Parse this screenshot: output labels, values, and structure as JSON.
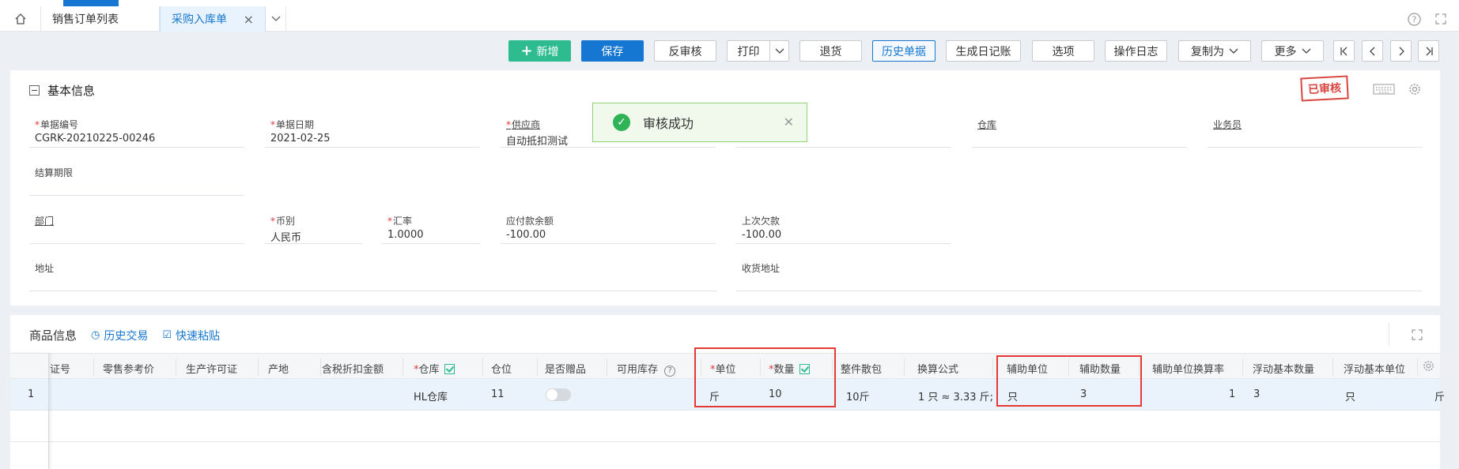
{
  "tabs": {
    "tab1": "销售订单列表",
    "tab2": "采购入库单"
  },
  "toolbar": {
    "add": "新增",
    "save": "保存",
    "unaudit": "反审核",
    "print": "打印",
    "return": "退货",
    "history": "历史单据",
    "journal": "生成日记账",
    "options": "选项",
    "oplog": "操作日志",
    "copyas": "复制为",
    "more": "更多"
  },
  "basic": {
    "title": "基本信息",
    "stamp": "已审核",
    "fields": {
      "doc_no": {
        "label": "单据编号",
        "value": "CGRK-20210225-00246"
      },
      "doc_date": {
        "label": "单据日期",
        "value": "2021-02-25"
      },
      "supplier": {
        "label": "供应商",
        "value": "自动抵扣测试"
      },
      "warehouse": {
        "label": "仓库",
        "value": ""
      },
      "salesman": {
        "label": "业务员",
        "value": ""
      },
      "settle": {
        "label": "结算期限",
        "value": ""
      },
      "dept": {
        "label": "部门",
        "value": ""
      },
      "currency": {
        "label": "币别",
        "value": "人民币"
      },
      "rate": {
        "label": "汇率",
        "value": "1.0000"
      },
      "payable": {
        "label": "应付款余额",
        "value": "-100.00"
      },
      "last_debt": {
        "label": "上次欠款",
        "value": "-100.00"
      },
      "address": {
        "label": "地址",
        "value": ""
      },
      "recv_address": {
        "label": "收货地址",
        "value": ""
      }
    }
  },
  "toast": {
    "message": "审核成功"
  },
  "goods": {
    "title": "商品信息",
    "history_trade": "历史交易",
    "quick_paste": "快速粘贴",
    "columns": {
      "c1": "证号",
      "c2": "零售参考价",
      "c3": "生产许可证",
      "c4": "产地",
      "c5": "含税折扣金额",
      "c6": "仓库",
      "c7": "仓位",
      "c8": "是否赠品",
      "c9": "可用库存",
      "c10": "单位",
      "c11": "数量",
      "c12": "整件散包",
      "c13": "换算公式",
      "c14": "辅助单位",
      "c15": "辅助数量",
      "c16": "辅助单位换算率",
      "c17": "浮动基本数量",
      "c18": "浮动基本单位"
    },
    "row": {
      "index": "1",
      "warehouse": "HL仓库",
      "position": "11",
      "unit": "斤",
      "qty": "10",
      "pack": "10斤",
      "formula": "1 只 ≈ 3.33 斤;",
      "aux_unit": "只",
      "aux_qty": "3",
      "aux_rate": "1",
      "float_qty": "3",
      "float_unit": "只",
      "tail": "斤"
    }
  }
}
